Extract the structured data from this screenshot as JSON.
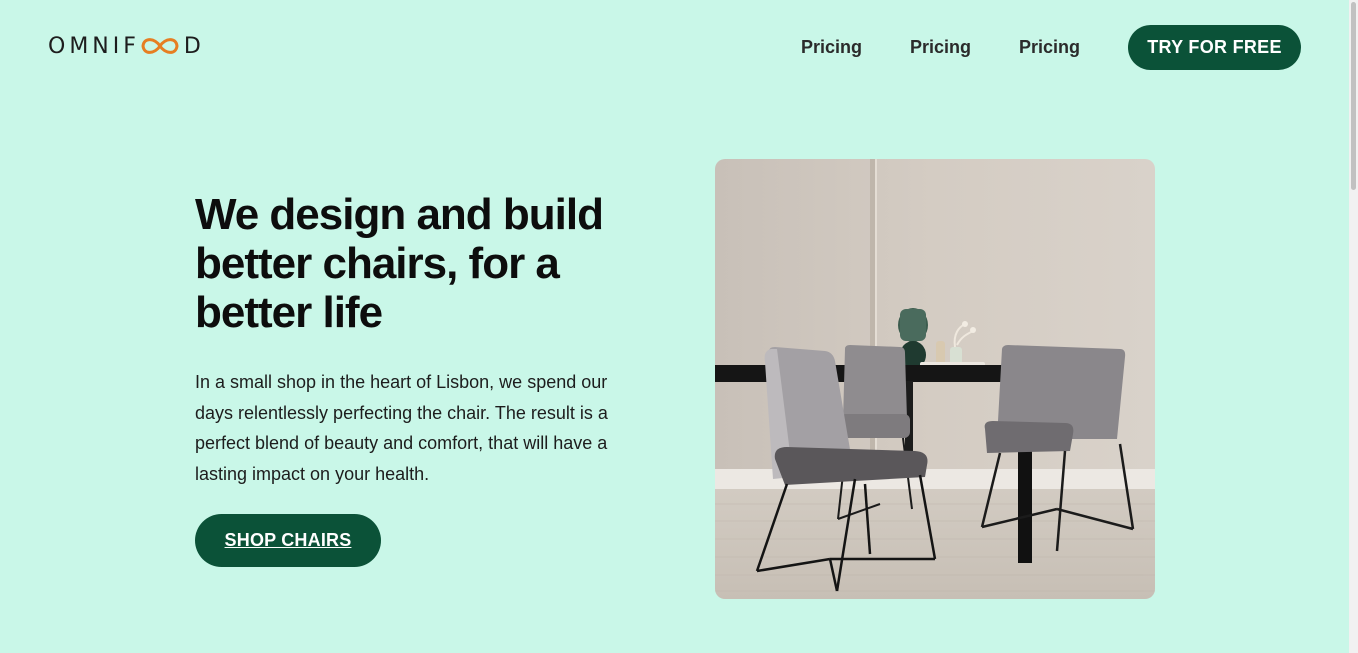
{
  "header": {
    "logo": {
      "text_before": "OMNIF",
      "text_after": "D",
      "icon": "infinity-icon",
      "brand_color": "#e67e22"
    },
    "nav": [
      {
        "label": "Pricing"
      },
      {
        "label": "Pricing"
      },
      {
        "label": "Pricing"
      }
    ],
    "cta_label": "TRY FOR FREE"
  },
  "hero": {
    "title": "We design and build better chairs, for a better life",
    "description": "In a small shop in the heart of Lisbon, we spend our days relentlessly perfecting the chair. The result is a perfect blend of beauty and comfort, that will have a lasting impact on your health.",
    "button_label": "SHOP CHAIRS",
    "image": "dining-table-with-chairs-photo"
  },
  "colors": {
    "background": "#c9f7e8",
    "accent": "#0b5238",
    "text": "#111111"
  }
}
